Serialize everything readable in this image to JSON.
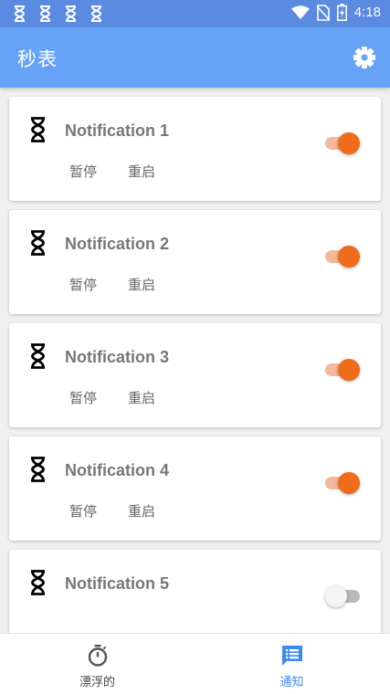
{
  "status_bar": {
    "time": "4:18",
    "left_icons": [
      "hourglass-icon",
      "hourglass-icon",
      "hourglass-icon",
      "hourglass-icon"
    ],
    "right_icons": [
      "wifi-icon",
      "no-sim-icon",
      "battery-charging-icon"
    ]
  },
  "app_bar": {
    "title": "秒表",
    "settings_icon": "gear-icon",
    "color": "#66a3f7"
  },
  "notifications": [
    {
      "title": "Notification 1",
      "pause_label": "暂停",
      "reset_label": "重启",
      "enabled": true
    },
    {
      "title": "Notification 2",
      "pause_label": "暂停",
      "reset_label": "重启",
      "enabled": true
    },
    {
      "title": "Notification 3",
      "pause_label": "暂停",
      "reset_label": "重启",
      "enabled": true
    },
    {
      "title": "Notification 4",
      "pause_label": "暂停",
      "reset_label": "重启",
      "enabled": true
    },
    {
      "title": "Notification 5",
      "enabled": false
    }
  ],
  "bottom_nav": {
    "items": [
      {
        "label": "漂浮的",
        "icon": "stopwatch-icon",
        "active": false
      },
      {
        "label": "通知",
        "icon": "notification-list-icon",
        "active": true
      }
    ],
    "active_color": "#3d8bf0"
  },
  "colors": {
    "switch_on": "#ef6c1a",
    "switch_on_track": "#f3b99a",
    "status_bar": "#5a8be0"
  }
}
